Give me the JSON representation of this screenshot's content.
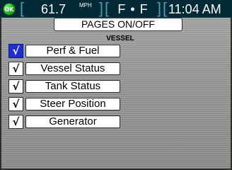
{
  "status": {
    "ok_label": "OK",
    "speed_value": "61.7",
    "speed_unit": "MPH",
    "heading": "F • F",
    "time": "11:04 AM"
  },
  "title": "PAGES ON/OFF",
  "section": "VESSEL",
  "check_glyph": "√",
  "pages": [
    {
      "label": "Perf & Fuel",
      "checked": true,
      "selected": true
    },
    {
      "label": "Vessel Status",
      "checked": true,
      "selected": false
    },
    {
      "label": "Tank Status",
      "checked": true,
      "selected": false
    },
    {
      "label": "Steer Position",
      "checked": true,
      "selected": false
    },
    {
      "label": "Generator",
      "checked": true,
      "selected": false
    }
  ]
}
